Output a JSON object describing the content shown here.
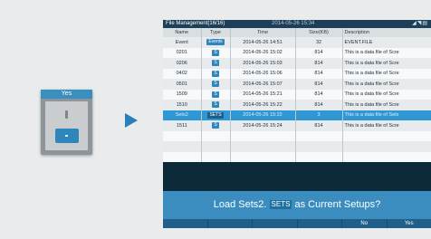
{
  "keypad": {
    "title": "Yes"
  },
  "screen": {
    "title": "File Management(16/16)",
    "datetime": "2014-05-26 15:34",
    "status_icons": "◢◥▤",
    "columns": [
      "Name",
      "Type",
      "Time",
      "Size(KB)",
      "Description"
    ],
    "rows": [
      {
        "name": "Event",
        "type": "Events",
        "time": "2014-05-26 14:51",
        "size": "32",
        "description": "EVENT.FILE"
      },
      {
        "name": "0201",
        "type": "S",
        "time": "2014-05-26 15:02",
        "size": "814",
        "description": "This is a data file of Scre"
      },
      {
        "name": "0206",
        "type": "S",
        "time": "2014-05-26 15:03",
        "size": "814",
        "description": "This is a data file of Scre"
      },
      {
        "name": "0402",
        "type": "S",
        "time": "2014-05-26 15:06",
        "size": "814",
        "description": "This is a data file of Scre"
      },
      {
        "name": "0501",
        "type": "S",
        "time": "2014-05-26 15:07",
        "size": "814",
        "description": "This is a data file of Scre"
      },
      {
        "name": "1509",
        "type": "S",
        "time": "2014-05-26 15:21",
        "size": "814",
        "description": "This is a data file of Scre"
      },
      {
        "name": "1510",
        "type": "S",
        "time": "2014-05-26 15:22",
        "size": "814",
        "description": "This is a data file of Scre"
      },
      {
        "name": "Sets2",
        "type": "SETS",
        "time": "2014-05-26 15:22",
        "size": "3",
        "description": "This is a data file of Sets"
      },
      {
        "name": "1511",
        "type": "S",
        "time": "2014-05-26 15:24",
        "size": "814",
        "description": "This is a data file of Scre"
      },
      {
        "name": "",
        "type": "",
        "time": "",
        "size": "",
        "description": ""
      },
      {
        "name": "",
        "type": "",
        "time": "",
        "size": "",
        "description": ""
      },
      {
        "name": "",
        "type": "",
        "time": "",
        "size": "",
        "description": ""
      }
    ],
    "selected_row": 7,
    "dialog": {
      "prefix": "Load Sets2.",
      "badge": "SETS",
      "suffix": "as Current Setups?"
    },
    "softkeys": [
      "",
      "",
      "",
      "",
      "No",
      "Yes"
    ]
  },
  "colors": {
    "accent": "#2e97d4",
    "dialog": "#3b8dbf",
    "screen_bg": "#0d2a3a"
  }
}
